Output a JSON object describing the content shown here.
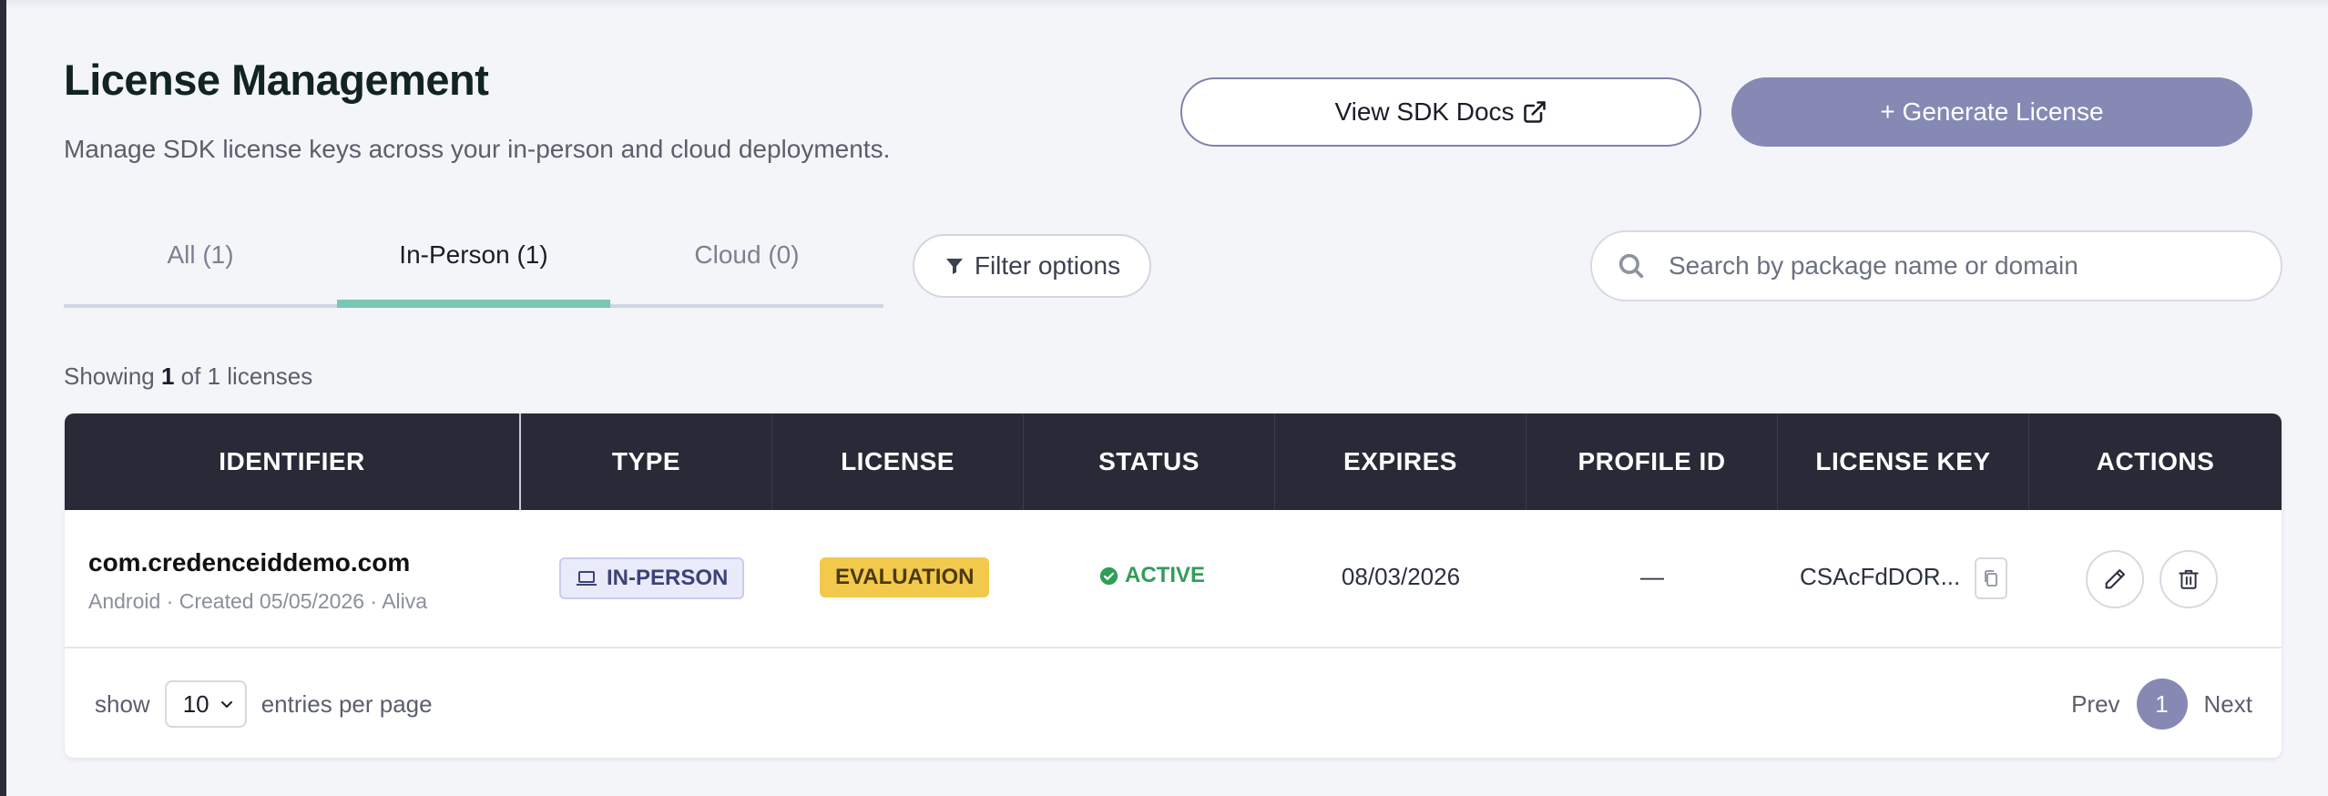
{
  "header": {
    "title": "License Management",
    "subtitle": "Manage SDK license keys across your in-person and cloud deployments."
  },
  "actions": {
    "docs_label": "View SDK Docs",
    "generate_label": "+ Generate License"
  },
  "tabs": [
    {
      "label": "All (1)",
      "active": false
    },
    {
      "label": "In-Person (1)",
      "active": true
    },
    {
      "label": "Cloud (0)",
      "active": false
    }
  ],
  "filter": {
    "label": "Filter options"
  },
  "search": {
    "placeholder": "Search by package name or domain",
    "value": ""
  },
  "summary": {
    "prefix": "Showing",
    "shown": "1",
    "suffix": "of 1 licenses"
  },
  "table": {
    "columns": [
      "IDENTIFIER",
      "TYPE",
      "LICENSE",
      "STATUS",
      "EXPIRES",
      "PROFILE ID",
      "LICENSE KEY",
      "ACTIONS"
    ],
    "rows": [
      {
        "identifier": "com.credenceiddemo.com",
        "meta": "Android · Created 05/05/2026 · Aliva",
        "type": "IN-PERSON",
        "license": "EVALUATION",
        "status": "ACTIVE",
        "expires": "08/03/2026",
        "profile_id": "—",
        "license_key": "CSAcFdDOR..."
      }
    ]
  },
  "pagination": {
    "show_label": "show",
    "per_page": "10",
    "entries_label": "entries per page",
    "prev": "Prev",
    "current": "1",
    "next": "Next"
  },
  "colors": {
    "accent": "#8589b3",
    "tab_underline": "#7ac6b4",
    "table_header": "#282a38",
    "license_badge": "#f2c94c",
    "status_active": "#2f9e58"
  },
  "icons": [
    "external-link-icon",
    "filter-icon",
    "search-icon",
    "laptop-icon",
    "check-circle-icon",
    "copy-icon",
    "edit-icon",
    "trash-icon",
    "chevron-down-icon"
  ]
}
